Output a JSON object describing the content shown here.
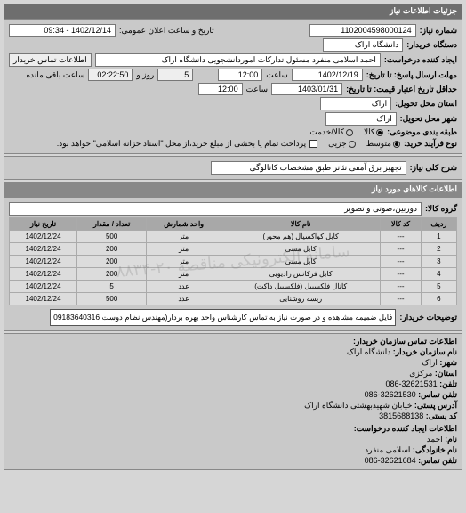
{
  "header": {
    "title": "جزئیات اطلاعات نیاز"
  },
  "req": {
    "number_lbl": "شماره نیاز:",
    "number": "1102004598000124",
    "pubdate_lbl": "تاریخ و ساعت اعلان عمومی:",
    "pubdate": "1402/12/14 - 09:34",
    "buyer_lbl": "دستگاه خریدار:",
    "buyer": "دانشگاه اراک",
    "creator_lbl": "ایجاد کننده درخواست:",
    "creator": "احمد  اسلامی منفرد مسئول تدارکات اموردانشجویی دانشگاه اراک",
    "contact_btn": "اطلاعات تماس خریدار",
    "deadline_lbl": "مهلت ارسال پاسخ: تا تاریخ:",
    "deadline_date": "1402/12/19",
    "time_lbl": "ساعت",
    "deadline_time": "12:00",
    "remain_lbl": "و",
    "remain_days": "5",
    "remain_days_lbl": "روز و",
    "remain_time": "02:22:50",
    "remain_time_lbl": "ساعت باقی مانده",
    "validity_lbl": "حداقل تاریخ اعتبار قیمت: تا تاریخ:",
    "validity_date": "1403/01/31",
    "validity_time": "12:00",
    "loc_lbl": "استان محل تحویل:",
    "loc": "اراک",
    "city_lbl": "شهر محل تحویل:",
    "city": "اراک",
    "class_lbl": "طبقه بندی موضوعی:",
    "class_good": "کالا",
    "class_service": "کالا/خدمت",
    "process_lbl": "نوع فرآیند خرید:",
    "proc_mid": "متوسط",
    "proc_part": "جزیی",
    "proc_desc": "پرداخت تمام یا بخشی از مبلغ خرید،از محل \"اسناد خزانه اسلامی\" خواهد بود.",
    "title_lbl": "شرح کلی نیاز:",
    "title": "تجهیز برق آمفی تئاتر طبق مشخصات کاتالوگی"
  },
  "goods": {
    "head": "اطلاعات کالاهای مورد نیاز",
    "group_lbl": "گروه کالا:",
    "group": "دوربین،صوتی و تصویر",
    "cols": {
      "row": "ردیف",
      "code": "کد کالا",
      "name": "نام کالا",
      "unit": "واحد شمارش",
      "qty": "تعداد / مقدار",
      "date": "تاریخ نیاز"
    },
    "rows": [
      {
        "i": "1",
        "code": "---",
        "name": "کابل کواکسیال (هم محور)",
        "unit": "متر",
        "qty": "500",
        "date": "1402/12/24"
      },
      {
        "i": "2",
        "code": "---",
        "name": "کابل مسی",
        "unit": "متر",
        "qty": "200",
        "date": "1402/12/24"
      },
      {
        "i": "3",
        "code": "---",
        "name": "کابل مسی",
        "unit": "متر",
        "qty": "200",
        "date": "1402/12/24"
      },
      {
        "i": "4",
        "code": "---",
        "name": "کابل فرکانس رادیویی",
        "unit": "متر",
        "qty": "200",
        "date": "1402/12/24"
      },
      {
        "i": "5",
        "code": "---",
        "name": "کانال فلکسیبل (فلکسیبل داکت)",
        "unit": "عدد",
        "qty": "5",
        "date": "1402/12/24"
      },
      {
        "i": "6",
        "code": "---",
        "name": "ریسه روشنایی",
        "unit": "عدد",
        "qty": "500",
        "date": "1402/12/24"
      }
    ],
    "watermark": "سامانه الکترونیکی مناقصه ۲۰-۸۸۳۴",
    "note_lbl": "توضیحات خریدار:",
    "note": "فایل ضمیمه مشاهده و در صورت نیاز به تماس کارشناس واحد بهره بردار(مهندس نظام دوست 09183640316"
  },
  "contact": {
    "head": "اطلاعات تماس سازمان خریدار:",
    "org_lbl": "نام سازمان خریدار:",
    "org": "دانشگاه اراک",
    "city_lbl": "شهر:",
    "city": "اراک",
    "prov_lbl": "استان:",
    "prov": "مرکزی",
    "tel_lbl": "تلفن:",
    "tel": "32621531-086",
    "fax_lbl": "تلفن تماس:",
    "fax": "32621530-086",
    "addr_lbl": "آدرس پستی:",
    "addr": "خیابان شهیدبهشتی دانشگاه اراک",
    "zip_lbl": "کد پستی:",
    "zip": "3815688138"
  },
  "creator": {
    "head": "اطلاعات ایجاد کننده درخواست:",
    "name_lbl": "نام:",
    "name": "احمد",
    "family_lbl": "نام خانوادگی:",
    "family": "اسلامی منفرد",
    "tel_lbl": "تلفن تماس:",
    "tel": "32621684-086"
  }
}
